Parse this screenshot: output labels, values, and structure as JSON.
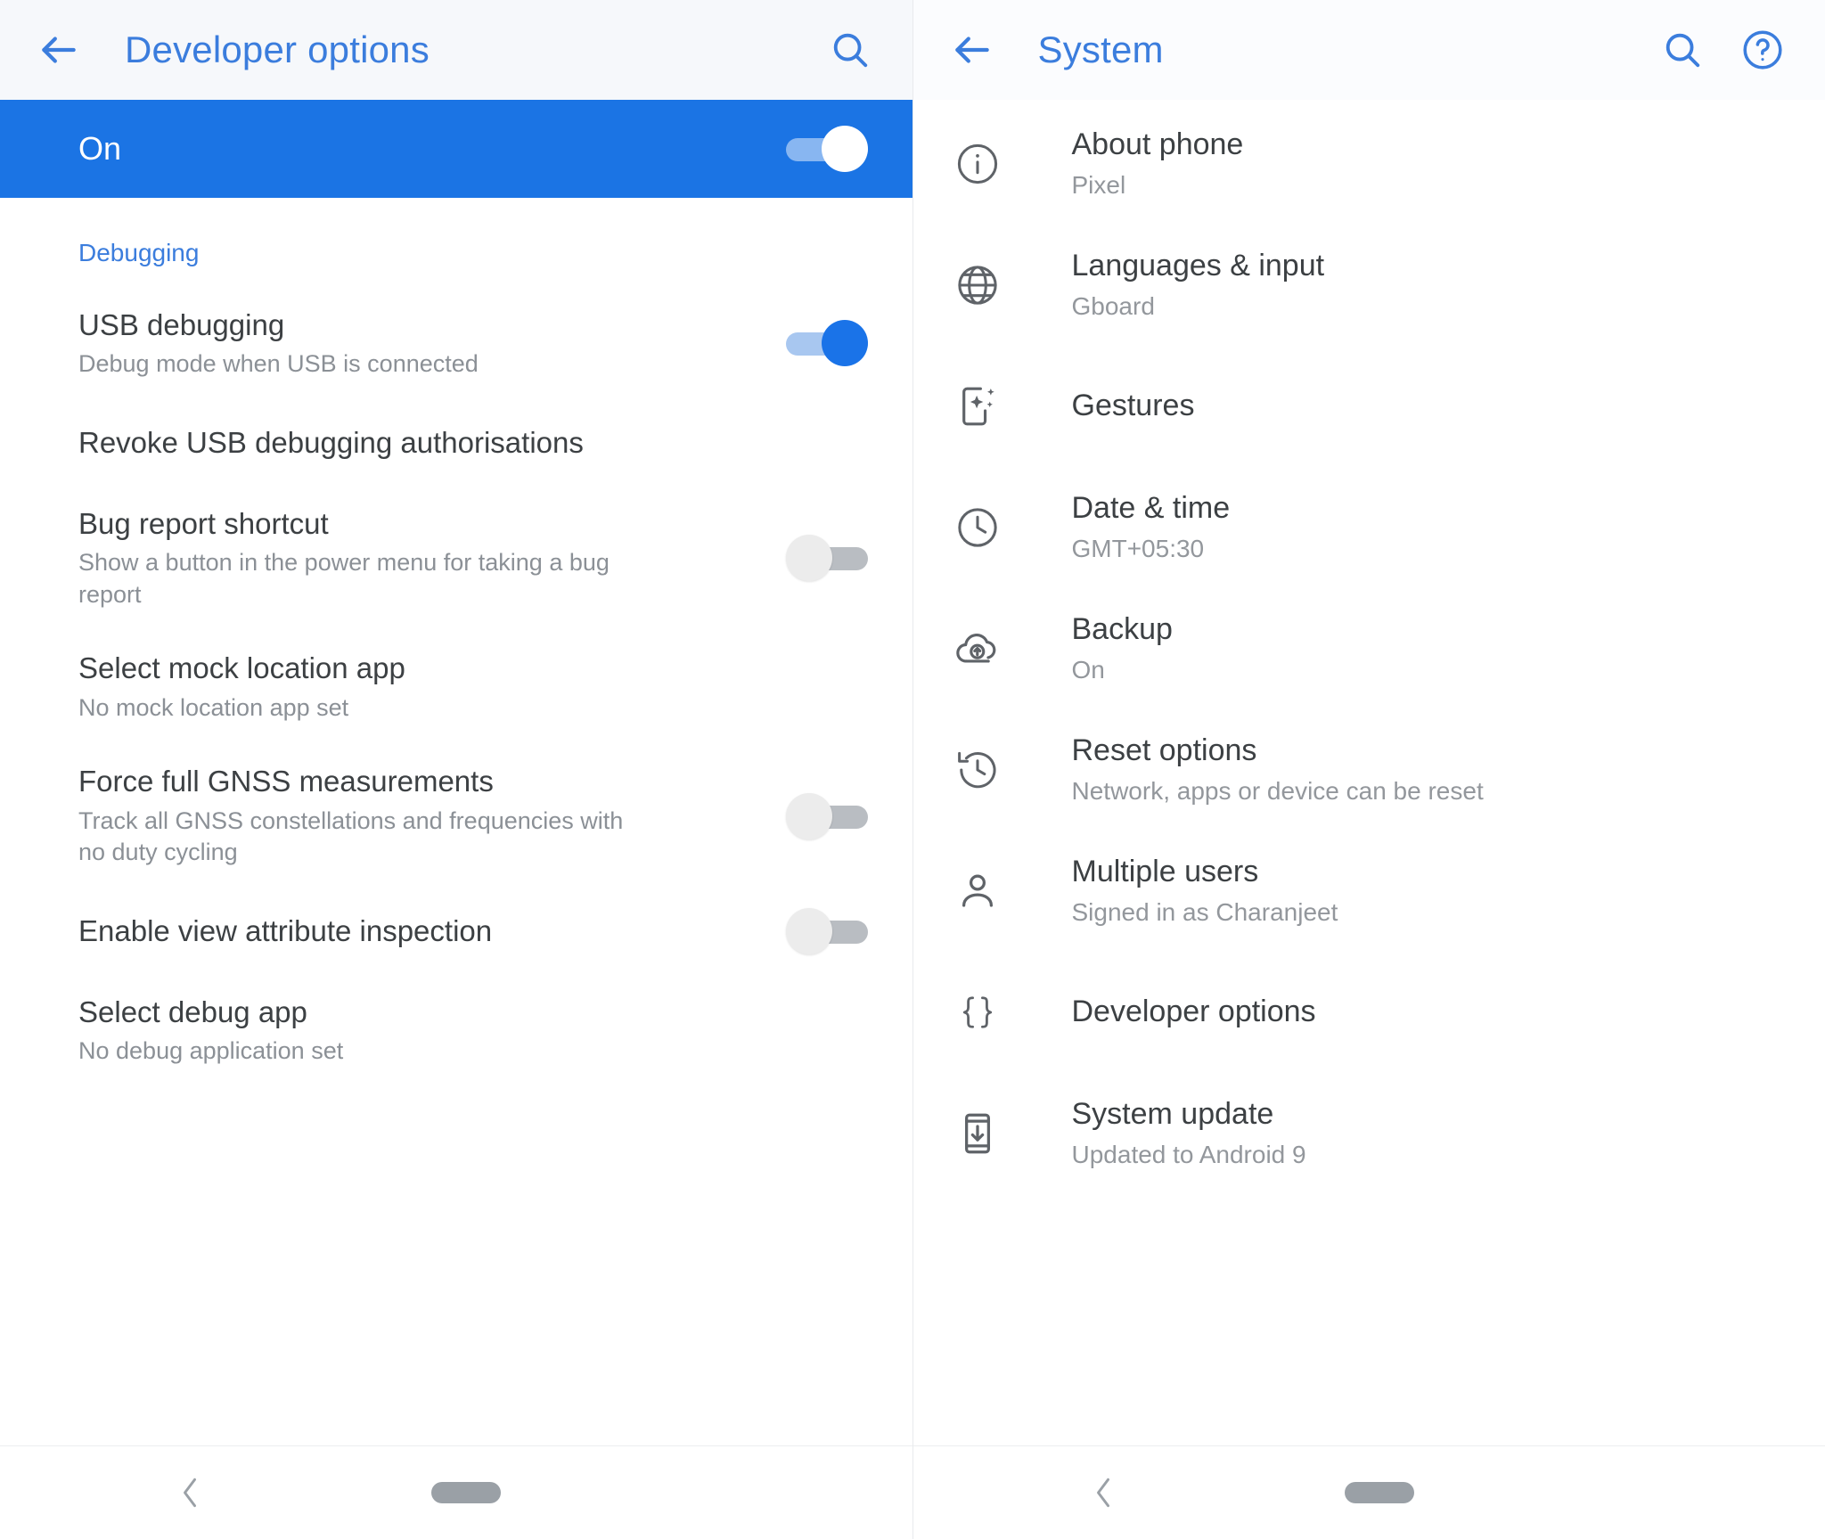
{
  "left_panel": {
    "appbar": {
      "back_icon": "back-arrow-icon",
      "title": "Developer options",
      "search_icon": "search-icon"
    },
    "master_switch": {
      "label": "On",
      "state": "on"
    },
    "sections": [
      {
        "header": "Debugging",
        "items": [
          {
            "title": "USB debugging",
            "summary": "Debug mode when USB is connected",
            "control": "switch",
            "state": "on"
          },
          {
            "title": "Revoke USB debugging authorisations",
            "summary": "",
            "control": "none",
            "state": ""
          },
          {
            "title": "Bug report shortcut",
            "summary": "Show a button in the power menu for taking a bug report",
            "control": "switch",
            "state": "off"
          },
          {
            "title": "Select mock location app",
            "summary": "No mock location app set",
            "control": "none",
            "state": ""
          },
          {
            "title": "Force full GNSS measurements",
            "summary": "Track all GNSS constellations and frequencies with no duty cycling",
            "control": "switch",
            "state": "off"
          },
          {
            "title": "Enable view attribute inspection",
            "summary": "",
            "control": "switch",
            "state": "off"
          },
          {
            "title": "Select debug app",
            "summary": "No debug application set",
            "control": "none",
            "state": ""
          }
        ]
      }
    ],
    "navbar": {
      "back_icon": "chevron-left-icon",
      "home_icon": "home-pill-icon"
    }
  },
  "right_panel": {
    "appbar": {
      "back_icon": "back-arrow-icon",
      "title": "System",
      "search_icon": "search-icon",
      "help_icon": "help-circle-icon"
    },
    "items": [
      {
        "icon": "info-circle-icon",
        "title": "About phone",
        "summary": "Pixel"
      },
      {
        "icon": "globe-icon",
        "title": "Languages & input",
        "summary": "Gboard"
      },
      {
        "icon": "gestures-icon",
        "title": "Gestures",
        "summary": ""
      },
      {
        "icon": "clock-icon",
        "title": "Date & time",
        "summary": "GMT+05:30"
      },
      {
        "icon": "cloud-upload-icon",
        "title": "Backup",
        "summary": "On"
      },
      {
        "icon": "history-icon",
        "title": "Reset options",
        "summary": "Network, apps or device can be reset"
      },
      {
        "icon": "person-icon",
        "title": "Multiple users",
        "summary": "Signed in as Charanjeet"
      },
      {
        "icon": "braces-icon",
        "title": "Developer options",
        "summary": ""
      },
      {
        "icon": "system-update-icon",
        "title": "System update",
        "summary": "Updated to Android 9"
      }
    ],
    "navbar": {
      "back_icon": "chevron-left-icon",
      "home_icon": "home-pill-icon"
    }
  },
  "colors": {
    "accent_blue": "#3b7ddd",
    "banner_blue": "#1b74e4",
    "toggle_on": "#1a73e8",
    "primary_text": "#3c4043",
    "secondary_text": "#8b9096"
  }
}
